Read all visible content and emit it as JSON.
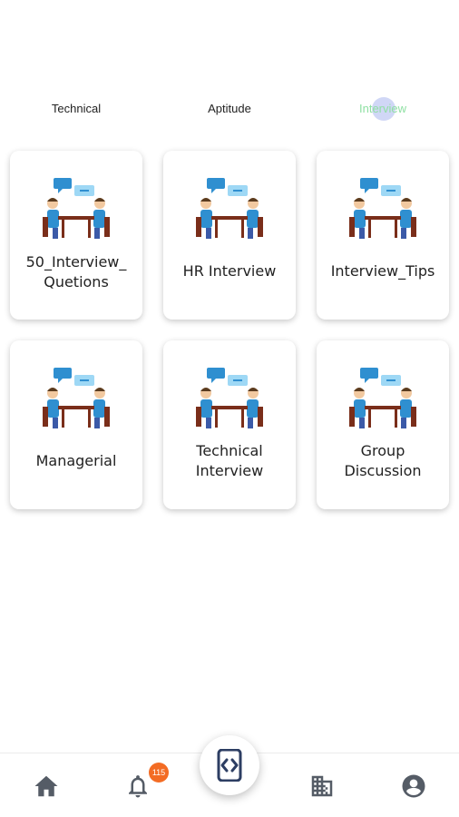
{
  "tabs": [
    {
      "label": "Technical",
      "selected": false
    },
    {
      "label": "Aptitude",
      "selected": false
    },
    {
      "label": "Interview",
      "selected": true
    }
  ],
  "accent_color": "#8fe0a3",
  "cards": [
    {
      "label_line1": "50_Interview_",
      "label_line2": "Quetions",
      "icon": "interview-meeting-illustration"
    },
    {
      "label_line1": "HR Interview",
      "label_line2": "",
      "icon": "interview-meeting-illustration"
    },
    {
      "label_line1": "Interview_Tips",
      "label_line2": "",
      "icon": "interview-meeting-illustration"
    },
    {
      "label_line1": "Managerial",
      "label_line2": "",
      "icon": "interview-meeting-illustration"
    },
    {
      "label_line1": "Technical",
      "label_line2": "Interview",
      "icon": "interview-meeting-illustration"
    },
    {
      "label_line1": "Group",
      "label_line2": "Discussion",
      "icon": "interview-meeting-illustration"
    }
  ],
  "bottom_nav": {
    "items": [
      "home-icon",
      "notification-bell-icon",
      "code-icon",
      "building-icon",
      "account-icon"
    ],
    "notification_count": "115"
  }
}
